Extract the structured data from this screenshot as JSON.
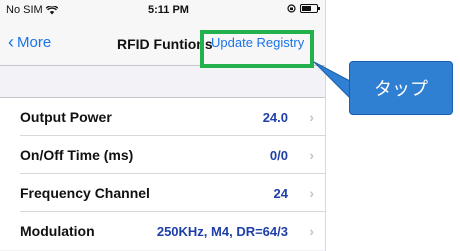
{
  "status_bar": {
    "carrier": "No SIM",
    "time": "5:11 PM"
  },
  "nav": {
    "back_label": "More",
    "title": "RFID Funtions",
    "action_label": "Update Registry"
  },
  "rows": [
    {
      "label": "Output Power",
      "value": "24.0"
    },
    {
      "label": "On/Off Time (ms)",
      "value": "0/0"
    },
    {
      "label": "Frequency Channel",
      "value": "24"
    },
    {
      "label": "Modulation",
      "value": "250KHz, M4, DR=64/3"
    }
  ],
  "annotation": {
    "text": "タップ"
  },
  "colors": {
    "accent": "#1a73e8",
    "highlight": "#22b14c",
    "callout": "#2f7fd3",
    "value": "#1f3fa8"
  }
}
